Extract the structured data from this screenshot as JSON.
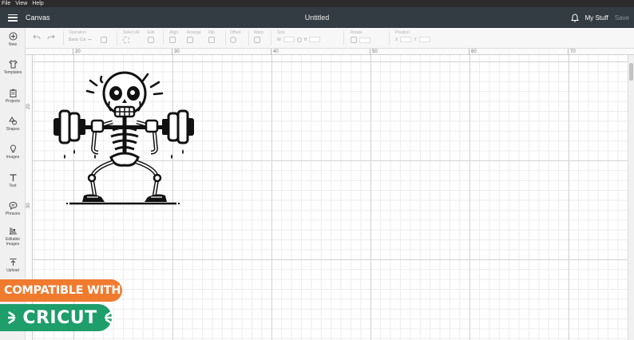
{
  "menu": [
    "File",
    "View",
    "Help"
  ],
  "header": {
    "app_title": "Canvas",
    "doc_title": "Untitled",
    "mystuff_label": "My Stuff",
    "save_label": "Save"
  },
  "toolbar": {
    "operation_label": "Operation",
    "operation_value": "Basic Cut",
    "selectall_label": "Select All",
    "edit_label": "Edit",
    "align_label": "Align",
    "arrange_label": "Arrange",
    "flip_label": "Flip",
    "offset_label": "Offset",
    "warp_label": "Warp",
    "size_label": "Size",
    "size_w": "W",
    "size_h": "H",
    "rotate_label": "Rotate",
    "position_label": "Position",
    "position_x": "X",
    "position_y": "Y"
  },
  "sidebar": {
    "items": [
      {
        "label": "New",
        "icon": "plus-circle-icon"
      },
      {
        "label": "Templates",
        "icon": "shirt-icon"
      },
      {
        "label": "Projects",
        "icon": "clipboard-icon"
      },
      {
        "label": "Shapes",
        "icon": "shapes-icon"
      },
      {
        "label": "Images",
        "icon": "lightbulb-icon"
      },
      {
        "label": "Text",
        "icon": "text-icon"
      },
      {
        "label": "Phrases",
        "icon": "speech-bubble-icon"
      },
      {
        "label": "Editable Images",
        "icon": "editable-image-icon"
      },
      {
        "label": "Upload",
        "icon": "upload-icon"
      }
    ]
  },
  "ruler": {
    "top": [
      "20",
      "30",
      "40",
      "50",
      "60",
      "70"
    ],
    "left": [
      "20",
      "30"
    ]
  },
  "badges": {
    "compatible": "COMPATIBLE WITH",
    "cricut": "CRICUT"
  },
  "colors": {
    "topbar": "#333b43",
    "badge_orange": "#f07a2e",
    "badge_green": "#1d9e6a"
  }
}
